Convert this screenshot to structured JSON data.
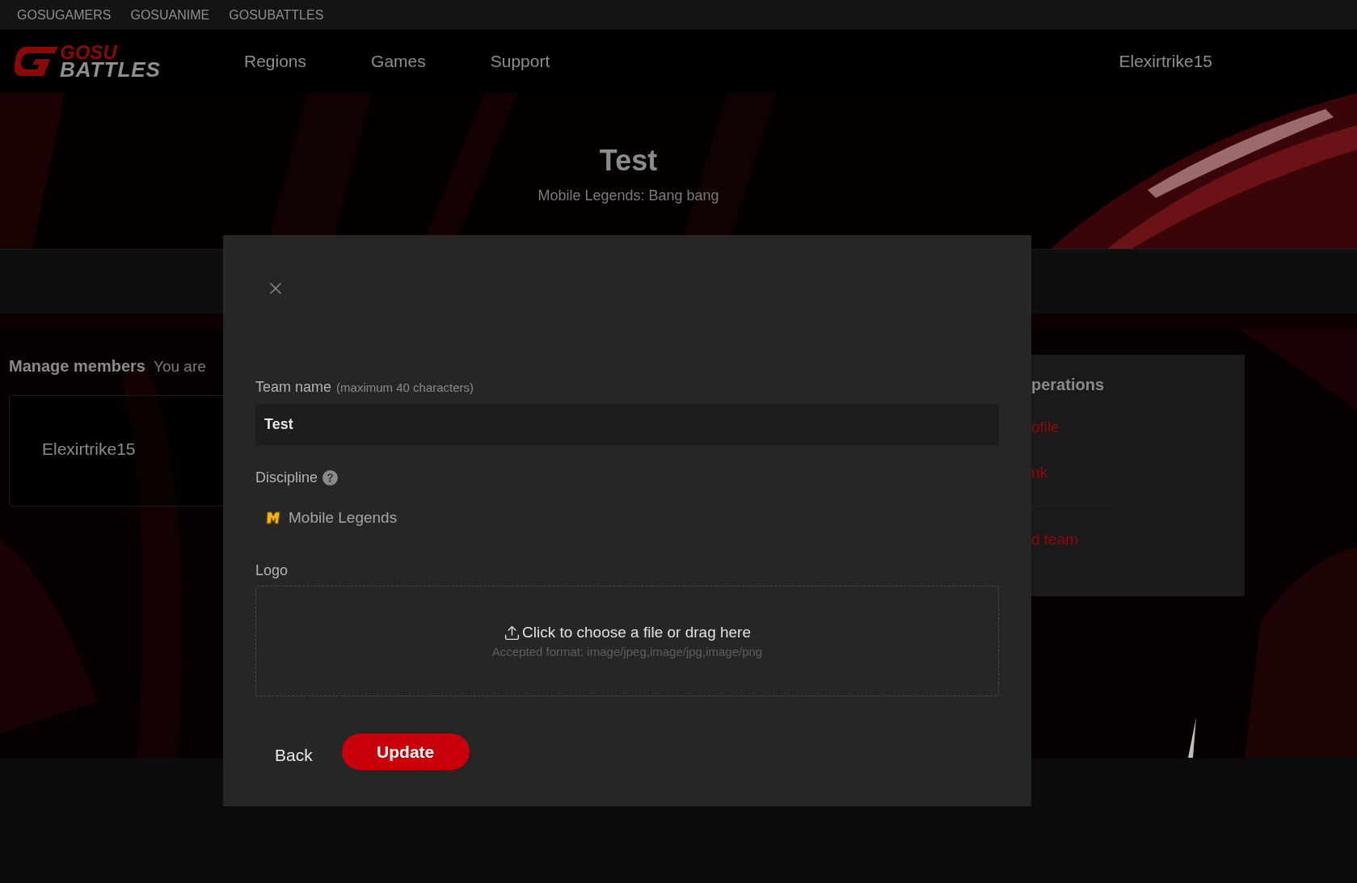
{
  "top_links": [
    "GOSUGAMERS",
    "GOSUANIME",
    "GOSUBATTLES"
  ],
  "logo": {
    "top": "GOSU",
    "bottom": "BATTLES"
  },
  "nav": {
    "items": [
      "Regions",
      "Games",
      "Support"
    ],
    "user": "Elexirtrike15"
  },
  "hero": {
    "title": "Test",
    "subtitle": "Mobile Legends: Bang bang"
  },
  "members": {
    "title": "Manage members",
    "note": "You are",
    "cards": [
      "Elexirtrike15"
    ]
  },
  "operations": {
    "title": "perations",
    "links": [
      "ofile",
      "nk",
      "d team"
    ]
  },
  "modal": {
    "team_name_label": "Team name",
    "team_name_hint": "(maximum 40 characters)",
    "team_name_value": "Test",
    "discipline_label": "Discipline",
    "discipline": "Mobile Legends",
    "logo_label": "Logo",
    "upload_text": "Click to choose a file or drag here",
    "upload_formats": "Accepted format: image/jpeg,image/jpg,image/png",
    "buttons": [
      {
        "label": "Back",
        "kind": "text"
      },
      {
        "label": "Update",
        "kind": "primary"
      }
    ]
  }
}
